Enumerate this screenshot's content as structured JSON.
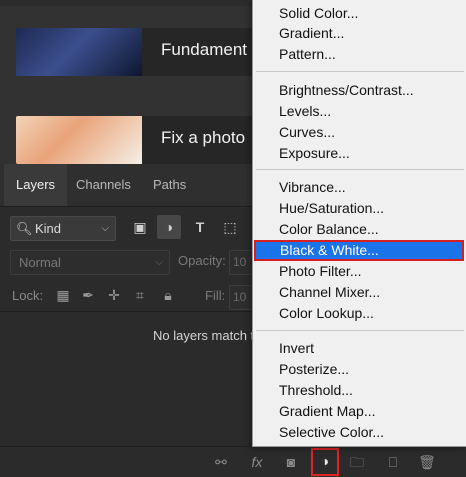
{
  "learn": {
    "cards": [
      {
        "title": "Fundament"
      },
      {
        "title": "Fix a photo"
      }
    ]
  },
  "layers_panel": {
    "tabs": [
      {
        "label": "Layers",
        "active": true
      },
      {
        "label": "Channels",
        "active": false
      },
      {
        "label": "Paths",
        "active": false
      }
    ],
    "kind_filter": "Kind",
    "blend_mode": "Normal",
    "opacity_label": "Opacity:",
    "opacity_value": "10",
    "lock_label": "Lock:",
    "fill_label": "Fill:",
    "fill_value": "10",
    "empty_message": "No layers match t"
  },
  "menu": {
    "groups": [
      [
        "Solid Color...",
        "Gradient...",
        "Pattern..."
      ],
      [
        "Brightness/Contrast...",
        "Levels...",
        "Curves...",
        "Exposure..."
      ],
      [
        "Vibrance...",
        "Hue/Saturation...",
        "Color Balance...",
        "Black & White...",
        "Photo Filter...",
        "Channel Mixer...",
        "Color Lookup..."
      ],
      [
        "Invert",
        "Posterize...",
        "Threshold...",
        "Gradient Map...",
        "Selective Color..."
      ]
    ],
    "selected": "Black & White...",
    "highlight_color": "#1a73e8",
    "annotation_color": "#d62020"
  },
  "icons": {
    "filter_buttons": [
      "image-filter-icon",
      "adjustment-filter-icon",
      "type-filter-icon",
      "shape-filter-icon"
    ],
    "lock_buttons": [
      "lock-transparent-icon",
      "lock-image-icon",
      "lock-position-icon",
      "lock-artboard-icon",
      "lock-all-icon"
    ],
    "bottom_buttons": [
      "link-layers-icon",
      "fx-icon",
      "add-mask-icon",
      "new-adjustment-layer-icon",
      "new-group-icon",
      "new-layer-icon",
      "delete-layer-icon"
    ]
  }
}
